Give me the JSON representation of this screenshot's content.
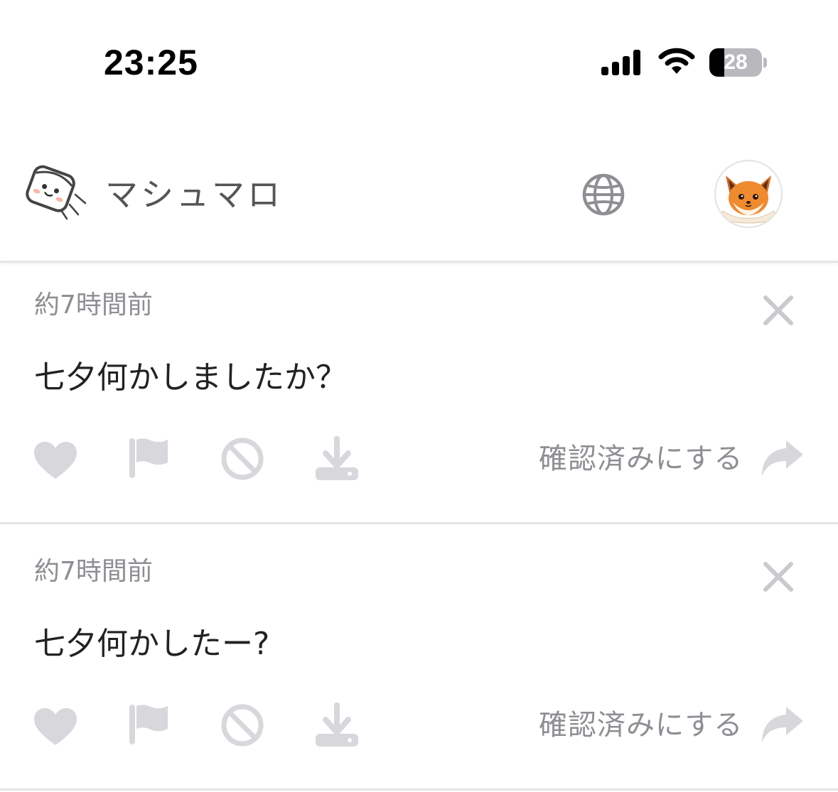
{
  "status_bar": {
    "time": "23:25",
    "battery_level": "28",
    "battery_fraction": 0.28,
    "icons": [
      "signal-icon",
      "wifi-icon",
      "battery-icon"
    ]
  },
  "header": {
    "title": "マシュマロ",
    "logo_icon": "marshmallow-logo-icon",
    "globe_icon": "globe-icon",
    "avatar": "fox-avatar"
  },
  "messages": [
    {
      "time": "約7時間前",
      "text": "七夕何かしましたか？",
      "confirm_label": "確認済みにする"
    },
    {
      "time": "約7時間前",
      "text": "七夕何かしたー?",
      "confirm_label": "確認済みにする"
    }
  ],
  "colors": {
    "icon_gray": "#d7d7dc",
    "text_gray": "#8e8e93",
    "title_gray": "#555555",
    "divider": "#e3e3e8",
    "fox_orange": "#f08a2e"
  }
}
